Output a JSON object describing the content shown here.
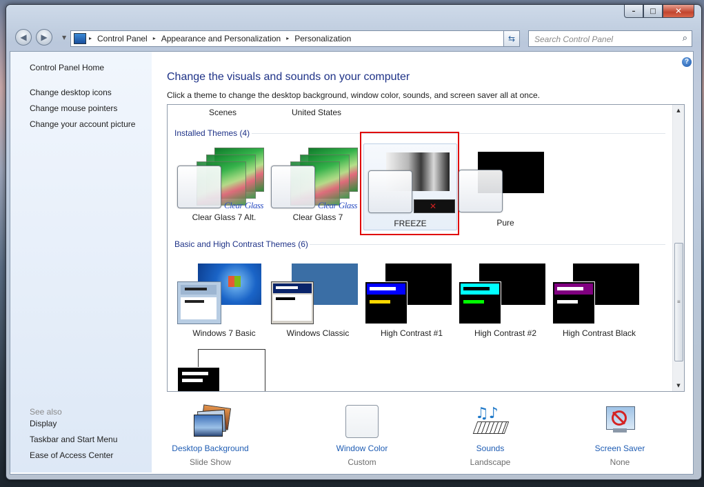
{
  "window": {
    "min_glyph": "–",
    "max_glyph": "□",
    "close_glyph": "✕"
  },
  "nav": {
    "back_glyph": "◀",
    "forward_glyph": "▶",
    "breadcrumbs": [
      "Control Panel",
      "Appearance and Personalization",
      "Personalization"
    ],
    "crumb_separator": "▸",
    "search_placeholder": "Search Control Panel"
  },
  "sidebar": {
    "home": "Control Panel Home",
    "links": [
      "Change desktop icons",
      "Change mouse pointers",
      "Change your account picture"
    ],
    "see_also_title": "See also",
    "see_also": [
      "Display",
      "Taskbar and Start Menu",
      "Ease of Access Center"
    ]
  },
  "main": {
    "help_glyph": "?",
    "title": "Change the visuals and sounds on your computer",
    "subtitle": "Click a theme to change the desktop background, window color, sounds, and screen saver all at once.",
    "partial_captions": [
      "Scenes",
      "United States"
    ],
    "installed_group": "Installed Themes (4)",
    "installed": [
      "Clear Glass 7 Alt.",
      "Clear Glass 7",
      "FREEZE",
      "Pure"
    ],
    "clear_glass_logo": "Clear Glass",
    "basic_group": "Basic and High Contrast Themes (6)",
    "basic": [
      "Windows 7 Basic",
      "Windows Classic",
      "High Contrast #1",
      "High Contrast #2",
      "High Contrast Black"
    ]
  },
  "bottom": [
    {
      "title": "Desktop Background",
      "value": "Slide Show"
    },
    {
      "title": "Window Color",
      "value": "Custom"
    },
    {
      "title": "Sounds",
      "value": "Landscape"
    },
    {
      "title": "Screen Saver",
      "value": "None"
    }
  ]
}
